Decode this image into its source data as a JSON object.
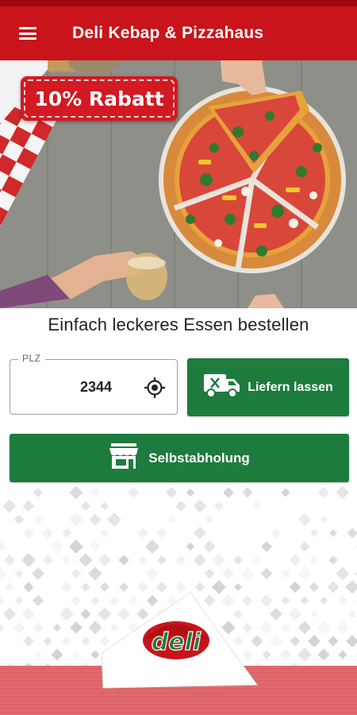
{
  "app": {
    "title": "Deli Kebap & Pizzahaus"
  },
  "icons": {
    "menu": "hamburger-menu-icon",
    "locate": "gps-locate-icon",
    "delivery": "delivery-truck-icon",
    "store": "storefront-icon"
  },
  "promo": {
    "badge_text": "10% Rabatt"
  },
  "main": {
    "tagline": "Einfach leckeres Essen bestellen",
    "plz_label": "PLZ",
    "plz_value": "2344",
    "deliver_label": "Liefern lassen",
    "pickup_label": "Selbstabholung"
  },
  "logo": {
    "text": "deli"
  },
  "colors": {
    "brand_red": "#c8141a",
    "status_bar": "#9e0b0e",
    "action_green": "#1e7b3e"
  }
}
